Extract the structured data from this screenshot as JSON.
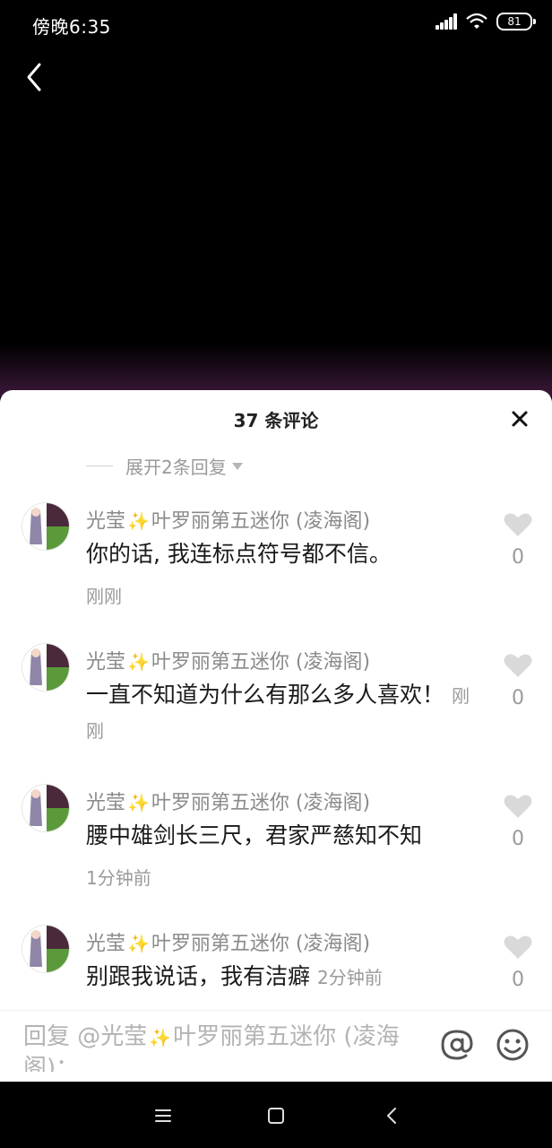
{
  "status_bar": {
    "time": "傍晚6:35",
    "battery": "81"
  },
  "sheet": {
    "title": "37 条评论",
    "expand_replies": "展开2条回复"
  },
  "comments": [
    {
      "username": "光莹",
      "username_suffix": "叶罗丽第五迷你 (凌海阁)",
      "text": "你的话, 我连标点符号都不信。",
      "time": "刚刚",
      "likes": "0"
    },
    {
      "username": "光莹",
      "username_suffix": "叶罗丽第五迷你 (凌海阁)",
      "text": "一直不知道为什么有那么多人喜欢！",
      "time": "刚刚",
      "likes": "0"
    },
    {
      "username": "光莹",
      "username_suffix": "叶罗丽第五迷你 (凌海阁)",
      "text": "腰中雄剑长三尺，君家严慈知不知",
      "time": "1分钟前",
      "likes": "0"
    },
    {
      "username": "光莹",
      "username_suffix": "叶罗丽第五迷你 (凌海阁)",
      "text": "别跟我说话，我有洁癖",
      "time": "2分钟前",
      "likes": "0"
    }
  ],
  "input": {
    "placeholder_prefix": "回复 @光莹",
    "placeholder_suffix": "叶罗丽第五迷你 (凌海阁)："
  },
  "icons": {
    "back": "chevron-left-icon",
    "close": "close-icon",
    "like": "heart-icon",
    "at": "at-icon",
    "emoji": "emoji-icon",
    "sparkle": "sparkle-icon",
    "nav_menu": "menu-icon",
    "nav_home": "home-square-icon",
    "nav_back": "back-triangle-icon"
  },
  "colors": {
    "accent_sparkle": "#f3c94a",
    "username": "#8a8a8a",
    "like_heart": "#d9d9d9"
  }
}
